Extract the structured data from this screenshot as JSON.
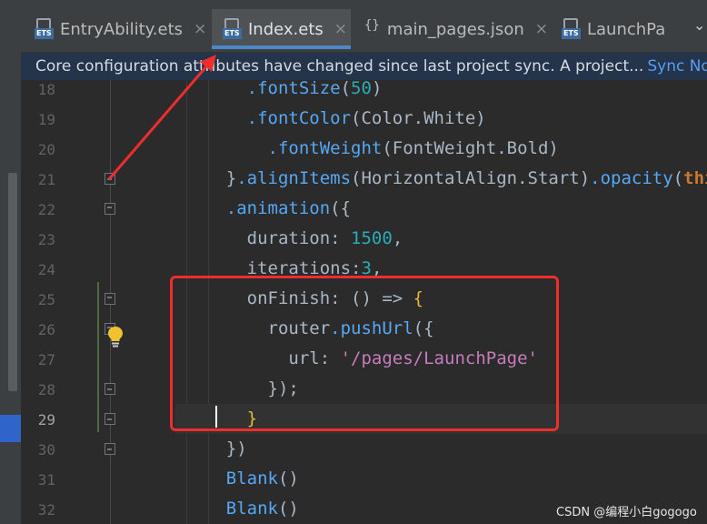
{
  "tabs": [
    {
      "label": "EntryAbility.ets",
      "icon": "ets-file-icon",
      "badge": "ETS",
      "close": "×",
      "active": false
    },
    {
      "label": "Index.ets",
      "icon": "ets-file-icon",
      "badge": "ETS",
      "close": "×",
      "active": true
    },
    {
      "label": "main_pages.json",
      "icon": "json-file-icon",
      "badge": "{}",
      "close": "×",
      "active": false
    },
    {
      "label": "LaunchPa",
      "icon": "ets-file-icon",
      "badge": "ETS",
      "close": "",
      "active": false
    }
  ],
  "tab_overflow": "⌄",
  "banner": {
    "text": "Core configuration attributes have changed since last project sync. A project...",
    "link": "Sync No"
  },
  "editor": {
    "current_line": 29,
    "lines": [
      {
        "n": "18",
        "segs": [
          [
            "      ",
            "d"
          ],
          [
            ".fontSize",
            "f"
          ],
          [
            "(",
            "d"
          ],
          [
            "50",
            "n"
          ],
          [
            ")",
            "d"
          ]
        ]
      },
      {
        "n": "19",
        "segs": [
          [
            "      ",
            "d"
          ],
          [
            ".fontColor",
            "f"
          ],
          [
            "(Color.White)",
            "d"
          ]
        ]
      },
      {
        "n": "20",
        "segs": [
          [
            "        ",
            "d"
          ],
          [
            ".fontWeight",
            "f"
          ],
          [
            "(FontWeight.Bold)",
            "d"
          ]
        ]
      },
      {
        "n": "21",
        "segs": [
          [
            "    }",
            "d"
          ],
          [
            ".alignItems",
            "f"
          ],
          [
            "(HorizontalAlign.Start)",
            "d"
          ],
          [
            ".opacity",
            "f"
          ],
          [
            "(",
            "d"
          ],
          [
            "this",
            "k"
          ]
        ]
      },
      {
        "n": "22",
        "segs": [
          [
            "    ",
            "d"
          ],
          [
            ".animation",
            "f"
          ],
          [
            "({",
            "d"
          ]
        ]
      },
      {
        "n": "23",
        "segs": [
          [
            "      duration",
            "d"
          ],
          [
            ": ",
            "d"
          ],
          [
            "1500",
            "n"
          ],
          [
            ",",
            "d"
          ]
        ]
      },
      {
        "n": "24",
        "segs": [
          [
            "      iterations",
            "d"
          ],
          [
            ":",
            "d"
          ],
          [
            "3",
            "n"
          ],
          [
            ",",
            "d"
          ]
        ]
      },
      {
        "n": "25",
        "segs": [
          [
            "      onFinish",
            "d"
          ],
          [
            ": () => ",
            "d"
          ],
          [
            "{",
            "y"
          ]
        ]
      },
      {
        "n": "26",
        "segs": [
          [
            "        router",
            "d"
          ],
          [
            ".pushUrl",
            "f"
          ],
          [
            "({",
            "d"
          ]
        ]
      },
      {
        "n": "27",
        "segs": [
          [
            "          url",
            "d"
          ],
          [
            ": ",
            "d"
          ],
          [
            "'/pages/LaunchPage'",
            "s"
          ]
        ]
      },
      {
        "n": "28",
        "segs": [
          [
            "        });",
            "d"
          ]
        ]
      },
      {
        "n": "29",
        "segs": [
          [
            "      ",
            "d"
          ],
          [
            "}",
            "y"
          ]
        ]
      },
      {
        "n": "30",
        "segs": [
          [
            "    })",
            "d"
          ]
        ]
      },
      {
        "n": "31",
        "segs": [
          [
            "    ",
            "d"
          ],
          [
            "Blank",
            "f"
          ],
          [
            "()",
            "d"
          ]
        ]
      },
      {
        "n": "32",
        "segs": [
          [
            "    ",
            "d"
          ],
          [
            "Blank",
            "f"
          ],
          [
            "()",
            "d"
          ]
        ]
      }
    ]
  },
  "colors": {
    "d": "#a9b7c6",
    "f": "#56a8f5",
    "n": "#2aacb8",
    "k": "#cc7832",
    "s": "#c77dbb",
    "y": "#e8ba36",
    "annotation": "#ef2d2d"
  },
  "watermark": "CSDN @编程小白gogogo"
}
